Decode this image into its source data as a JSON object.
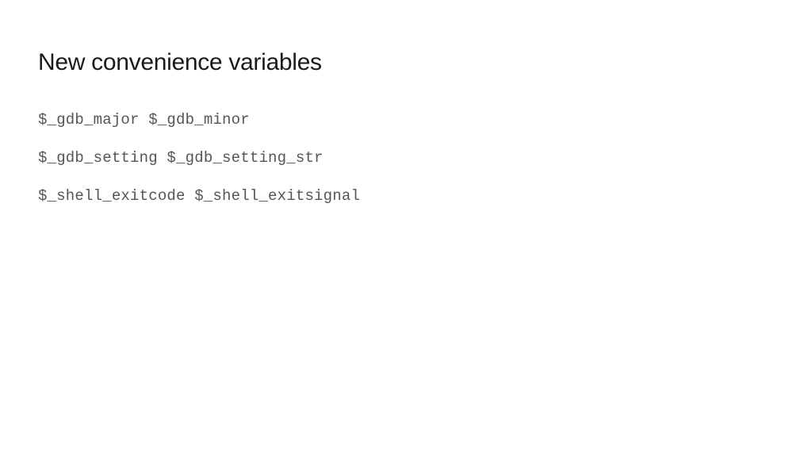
{
  "title": "New convenience variables",
  "lines": [
    "$_gdb_major $_gdb_minor",
    "$_gdb_setting $_gdb_setting_str",
    "$_shell_exitcode $_shell_exitsignal"
  ]
}
